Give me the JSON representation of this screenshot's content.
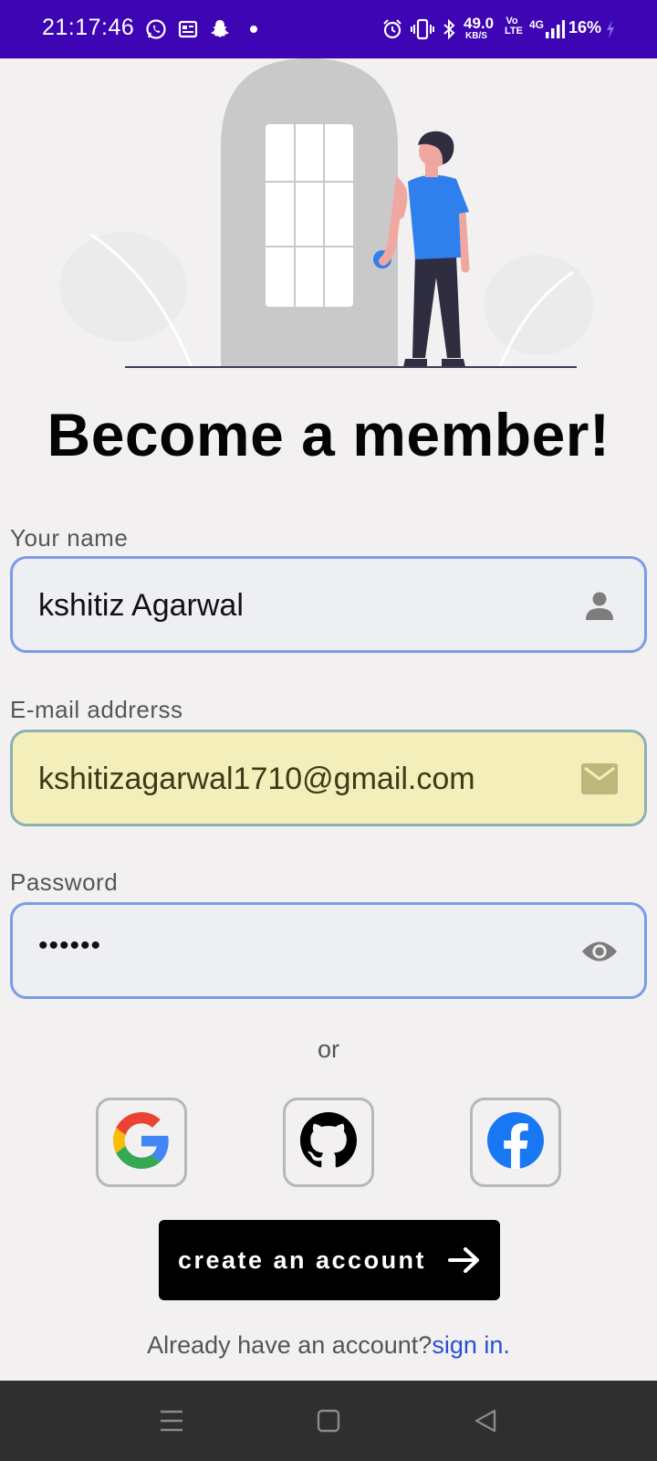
{
  "status_bar": {
    "time": "21:17:46",
    "network_speed": "49.0",
    "network_speed_unit": "KB/S",
    "volte": "Vo LTE",
    "network_type": "4G",
    "battery": "16%",
    "icons": [
      "whatsapp-icon",
      "news-icon",
      "snapchat-icon",
      "dot-icon",
      "alarm-icon",
      "vibrate-icon",
      "bluetooth-icon",
      "signal-icon",
      "charging-icon"
    ]
  },
  "title": "Become a member!",
  "form": {
    "name": {
      "label": "Your name",
      "value": "kshitiz Agarwal",
      "icon": "person-icon"
    },
    "email": {
      "label": "E-mail addrerss",
      "value": "kshitizagarwal1710@gmail.com",
      "icon": "mail-icon"
    },
    "password": {
      "label": "Password",
      "value": "••••••",
      "icon": "eye-icon"
    }
  },
  "or_text": "or",
  "social": [
    {
      "name": "google",
      "icon": "google-icon"
    },
    {
      "name": "github",
      "icon": "github-icon"
    },
    {
      "name": "facebook",
      "icon": "facebook-icon"
    }
  ],
  "create_button": {
    "label": "create an account",
    "icon": "arrow-right-icon"
  },
  "signin": {
    "prompt": "Already have an account?",
    "link": "sign in."
  },
  "colors": {
    "status_bar": "#3d05b4",
    "field_border": "#7a9ce8",
    "autofill_bg": "#f4eebb",
    "link": "#2a4fd6",
    "nav_bar": "#2f2f2f",
    "accent_blue": "#2f80ed"
  }
}
